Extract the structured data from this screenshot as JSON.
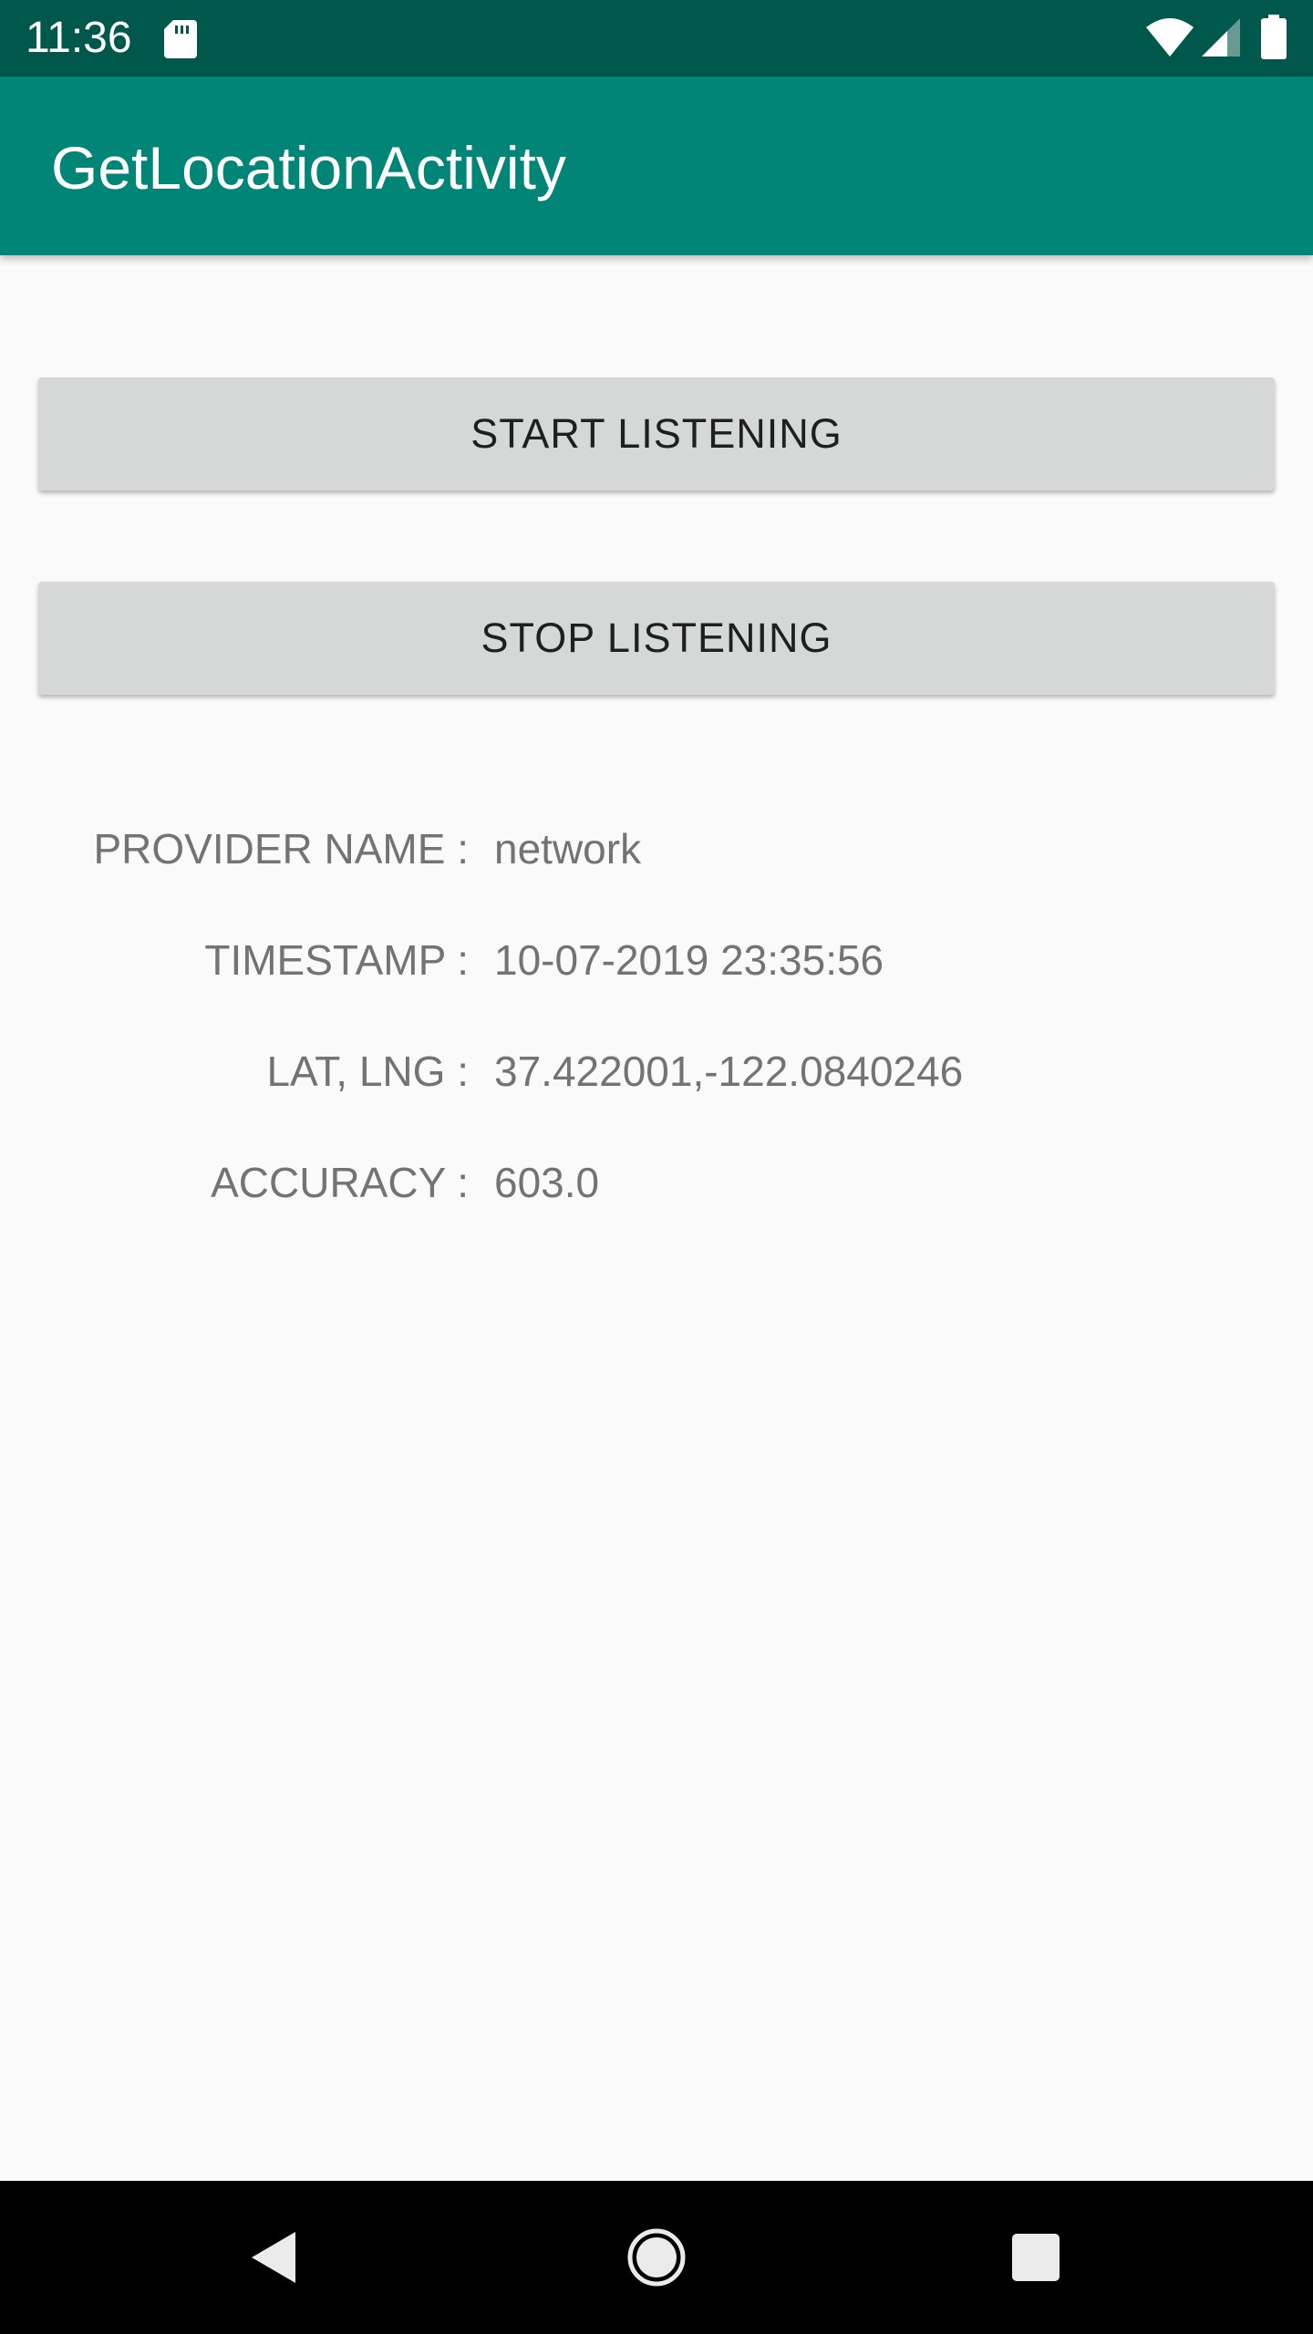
{
  "status_bar": {
    "time": "11:36",
    "icons": [
      "sd-card-icon",
      "wifi-icon",
      "cell-signal-icon",
      "battery-icon"
    ]
  },
  "app_bar": {
    "title": "GetLocationActivity"
  },
  "buttons": {
    "start_label": "START LISTENING",
    "stop_label": "STOP LISTENING"
  },
  "location_info": {
    "provider_label": "PROVIDER NAME :",
    "provider_value": "network",
    "timestamp_label": "TIMESTAMP :",
    "timestamp_value": "10-07-2019 23:35:56",
    "latlng_label": "LAT, LNG :",
    "latlng_value": "37.422001,-122.0840246",
    "accuracy_label": "ACCURACY :",
    "accuracy_value": "603.0"
  },
  "nav_bar": {
    "icons": [
      "back-icon",
      "home-icon",
      "recents-icon"
    ]
  },
  "colors": {
    "status_bar": "#00574b",
    "app_bar": "#008577",
    "background": "#fafafa",
    "button": "#d6d7d7",
    "label_text": "#737373"
  }
}
